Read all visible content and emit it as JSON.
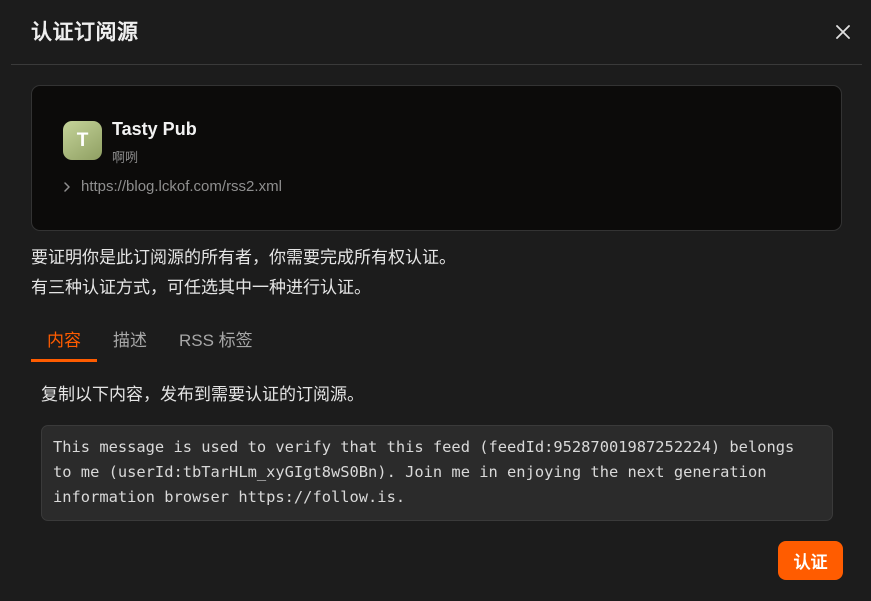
{
  "dialog": {
    "title": "认证订阅源",
    "close_icon": "close-icon"
  },
  "feed": {
    "avatar_letter": "T",
    "name": "Tasty Pub",
    "description": "啊咧",
    "url": "https://blog.lckof.com/rss2.xml",
    "url_icon": "chevron-right-icon"
  },
  "intro": {
    "line1": "要证明你是此订阅源的所有者，你需要完成所有权认证。",
    "line2": "有三种认证方式，可任选其中一种进行认证。"
  },
  "tabs": [
    {
      "label": "内容",
      "active": true
    },
    {
      "label": "描述",
      "active": false
    },
    {
      "label": "RSS 标签",
      "active": false
    }
  ],
  "content_tab": {
    "instructions": "复制以下内容，发布到需要认证的订阅源。",
    "message": "This message is used to verify that this feed (feedId:95287001987252224) belongs to me (userId:tbTarHLm_xyGIgt8wS0Bn). Join me in enjoying the next generation information browser https://follow.is."
  },
  "actions": {
    "verify_label": "认证"
  },
  "colors": {
    "accent": "#ff5c00",
    "background": "#1c1c1c",
    "card_background": "#0c0b0a",
    "code_background": "#2b2b2b"
  }
}
